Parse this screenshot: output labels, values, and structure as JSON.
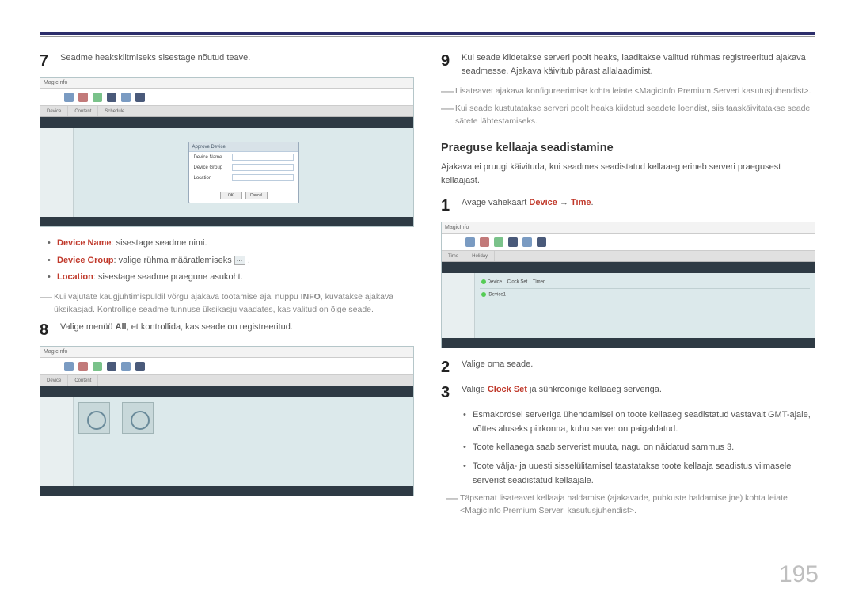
{
  "pageNumber": "195",
  "left": {
    "step7": "Seadme heakskiitmiseks sisestage nõutud teave.",
    "screenshot1Title": "MagicInfo",
    "dialogTitle": "Approve Device",
    "dialogField1": "Device Name",
    "dialogField2": "Device Group",
    "dialogField3": "Location",
    "dialogBtnOk": "OK",
    "dialogBtnCancel": "Cancel",
    "bullet1Label": "Device Name",
    "bullet1Text": ": sisestage seadme nimi.",
    "bullet2Label": "Device Group",
    "bullet2Text": ": valige rühma määratlemiseks ",
    "bullet3Label": "Location",
    "bullet3Text": ": sisestage seadme praegune asukoht.",
    "note1a": "Kui vajutate kaugjuhtimispuldil võrgu ajakava töötamise ajal nuppu ",
    "note1Bold": "INFO",
    "note1b": ", kuvatakse ajakava üksikasjad. Kontrollige seadme tunnuse üksikasju vaadates, kas valitud on õige seade.",
    "step8a": "Valige menüü ",
    "step8Bold": "All",
    "step8b": ", et kontrollida, kas seade on registreeritud."
  },
  "right": {
    "step9": "Kui seade kiidetakse serveri poolt heaks, laaditakse valitud rühmas registreeritud ajakava seadmesse. Ajakava käivitub pärast allalaadimist.",
    "noteR1": "Lisateavet ajakava konfigureerimise kohta leiate <MagicInfo Premium Serveri kasutusjuhendist>.",
    "noteR2": "Kui seade kustutatakse serveri poolt heaks kiidetud seadete loendist, siis taaskäivitatakse seade sätete lähtestamiseks.",
    "sectionTitle": "Praeguse kellaaja seadistamine",
    "sectionDesc": "Ajakava ei pruugi käivituda, kui seadmes seadistatud kellaaeg erineb serveri praegusest kellaajast.",
    "step1a": "Avage vahekaart ",
    "step1Bold1": "Device",
    "step1Arrow": " → ",
    "step1Bold2": "Time",
    "step1c": ".",
    "step2": "Valige oma seade.",
    "step3a": "Valige ",
    "step3Bold": "Clock Set",
    "step3b": " ja sünkroonige kellaaeg serveriga.",
    "sub1": "Esmakordsel serveriga ühendamisel on toote kellaaeg seadistatud vastavalt GMT-ajale, võttes aluseks piirkonna, kuhu server on paigaldatud.",
    "sub2": "Toote kellaaega saab serverist muuta, nagu on näidatud sammus 3.",
    "sub3": "Toote välja- ja uuesti sisselülitamisel taastatakse toote kellaaja seadistus viimasele serverist seadistatud kellaajale.",
    "noteR3": "Täpsemat lisateavet kellaaja haldamise (ajakavade, puhkuste haldamise jne) kohta leiate <MagicInfo Premium Serveri kasutusjuhendist>."
  }
}
